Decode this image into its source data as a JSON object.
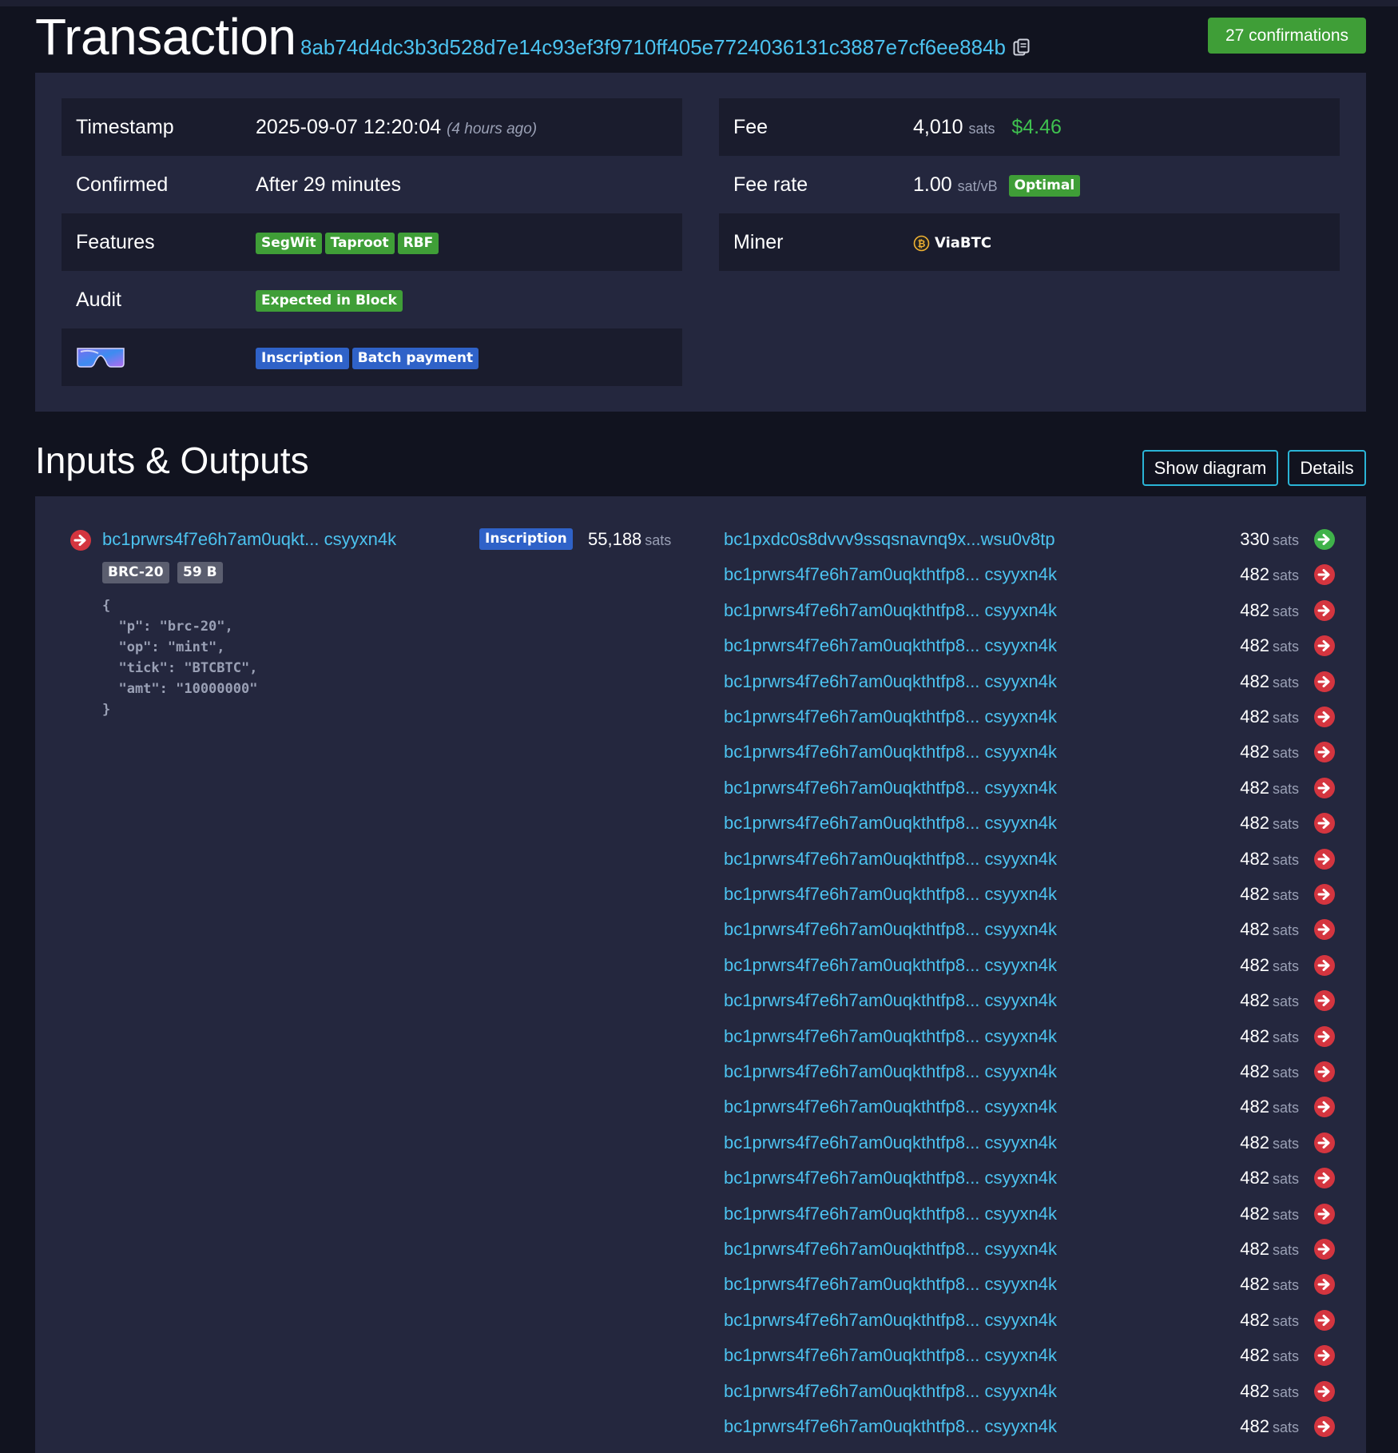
{
  "header": {
    "title": "Transaction",
    "txid": "8ab74d4dc3b3d528d7e14c93ef3f9710ff405e7724036131c3887e7cf6ee884b",
    "confirmations": "27 confirmations"
  },
  "summary": {
    "timestamp_label": "Timestamp",
    "timestamp_value": "2025-09-07 12:20:04",
    "timestamp_ago": "(4 hours ago)",
    "confirmed_label": "Confirmed",
    "confirmed_value": "After 29 minutes",
    "features_label": "Features",
    "features": [
      "SegWit",
      "Taproot",
      "RBF"
    ],
    "audit_label": "Audit",
    "audit_value": "Expected in Block",
    "goggles_tags": [
      "Inscription",
      "Batch payment"
    ],
    "fee_label": "Fee",
    "fee_sats": "4,010",
    "fee_unit": "sats",
    "fee_usd": "$4.46",
    "feerate_label": "Fee rate",
    "feerate_value": "1.00",
    "feerate_unit": "sat/vB",
    "feerate_badge": "Optimal",
    "miner_label": "Miner",
    "miner_value": "ViaBTC"
  },
  "io": {
    "title": "Inputs & Outputs",
    "show_diagram": "Show diagram",
    "details": "Details",
    "input": {
      "address": "bc1prwrs4f7e6h7am0uqkt... csyyxn4k",
      "badge": "Inscription",
      "amount": "55,188",
      "unit": "sats",
      "tags": [
        "BRC-20",
        "59 B"
      ],
      "inscription_json": "{\n  \"p\": \"brc-20\",\n  \"op\": \"mint\",\n  \"tick\": \"BTCBTC\",\n  \"amt\": \"10000000\"\n}"
    },
    "outputs": [
      {
        "address": "bc1pxdc0s8dvvv9ssqsnavnq9x...wsu0v8tp",
        "amount": "330",
        "unit": "sats",
        "status": "unspent"
      },
      {
        "address": "bc1prwrs4f7e6h7am0uqkthtfp8... csyyxn4k",
        "amount": "482",
        "unit": "sats",
        "status": "spent"
      },
      {
        "address": "bc1prwrs4f7e6h7am0uqkthtfp8... csyyxn4k",
        "amount": "482",
        "unit": "sats",
        "status": "spent"
      },
      {
        "address": "bc1prwrs4f7e6h7am0uqkthtfp8... csyyxn4k",
        "amount": "482",
        "unit": "sats",
        "status": "spent"
      },
      {
        "address": "bc1prwrs4f7e6h7am0uqkthtfp8... csyyxn4k",
        "amount": "482",
        "unit": "sats",
        "status": "spent"
      },
      {
        "address": "bc1prwrs4f7e6h7am0uqkthtfp8... csyyxn4k",
        "amount": "482",
        "unit": "sats",
        "status": "spent"
      },
      {
        "address": "bc1prwrs4f7e6h7am0uqkthtfp8... csyyxn4k",
        "amount": "482",
        "unit": "sats",
        "status": "spent"
      },
      {
        "address": "bc1prwrs4f7e6h7am0uqkthtfp8... csyyxn4k",
        "amount": "482",
        "unit": "sats",
        "status": "spent"
      },
      {
        "address": "bc1prwrs4f7e6h7am0uqkthtfp8... csyyxn4k",
        "amount": "482",
        "unit": "sats",
        "status": "spent"
      },
      {
        "address": "bc1prwrs4f7e6h7am0uqkthtfp8... csyyxn4k",
        "amount": "482",
        "unit": "sats",
        "status": "spent"
      },
      {
        "address": "bc1prwrs4f7e6h7am0uqkthtfp8... csyyxn4k",
        "amount": "482",
        "unit": "sats",
        "status": "spent"
      },
      {
        "address": "bc1prwrs4f7e6h7am0uqkthtfp8... csyyxn4k",
        "amount": "482",
        "unit": "sats",
        "status": "spent"
      },
      {
        "address": "bc1prwrs4f7e6h7am0uqkthtfp8... csyyxn4k",
        "amount": "482",
        "unit": "sats",
        "status": "spent"
      },
      {
        "address": "bc1prwrs4f7e6h7am0uqkthtfp8... csyyxn4k",
        "amount": "482",
        "unit": "sats",
        "status": "spent"
      },
      {
        "address": "bc1prwrs4f7e6h7am0uqkthtfp8... csyyxn4k",
        "amount": "482",
        "unit": "sats",
        "status": "spent"
      },
      {
        "address": "bc1prwrs4f7e6h7am0uqkthtfp8... csyyxn4k",
        "amount": "482",
        "unit": "sats",
        "status": "spent"
      },
      {
        "address": "bc1prwrs4f7e6h7am0uqkthtfp8... csyyxn4k",
        "amount": "482",
        "unit": "sats",
        "status": "spent"
      },
      {
        "address": "bc1prwrs4f7e6h7am0uqkthtfp8... csyyxn4k",
        "amount": "482",
        "unit": "sats",
        "status": "spent"
      },
      {
        "address": "bc1prwrs4f7e6h7am0uqkthtfp8... csyyxn4k",
        "amount": "482",
        "unit": "sats",
        "status": "spent"
      },
      {
        "address": "bc1prwrs4f7e6h7am0uqkthtfp8... csyyxn4k",
        "amount": "482",
        "unit": "sats",
        "status": "spent"
      },
      {
        "address": "bc1prwrs4f7e6h7am0uqkthtfp8... csyyxn4k",
        "amount": "482",
        "unit": "sats",
        "status": "spent"
      },
      {
        "address": "bc1prwrs4f7e6h7am0uqkthtfp8... csyyxn4k",
        "amount": "482",
        "unit": "sats",
        "status": "spent"
      },
      {
        "address": "bc1prwrs4f7e6h7am0uqkthtfp8... csyyxn4k",
        "amount": "482",
        "unit": "sats",
        "status": "spent"
      },
      {
        "address": "bc1prwrs4f7e6h7am0uqkthtfp8... csyyxn4k",
        "amount": "482",
        "unit": "sats",
        "status": "spent"
      },
      {
        "address": "bc1prwrs4f7e6h7am0uqkthtfp8... csyyxn4k",
        "amount": "482",
        "unit": "sats",
        "status": "spent"
      },
      {
        "address": "bc1prwrs4f7e6h7am0uqkthtfp8... csyyxn4k",
        "amount": "482",
        "unit": "sats",
        "status": "spent"
      }
    ]
  },
  "colors": {
    "background": "#11131f",
    "card": "#24273e",
    "row_dark": "#1a1c2d",
    "link": "#4cc3f0",
    "green": "#3f9e37",
    "blue_tag": "#2f62c8",
    "spent_red": "#d4353f",
    "unspent_green": "#3fb24a"
  }
}
